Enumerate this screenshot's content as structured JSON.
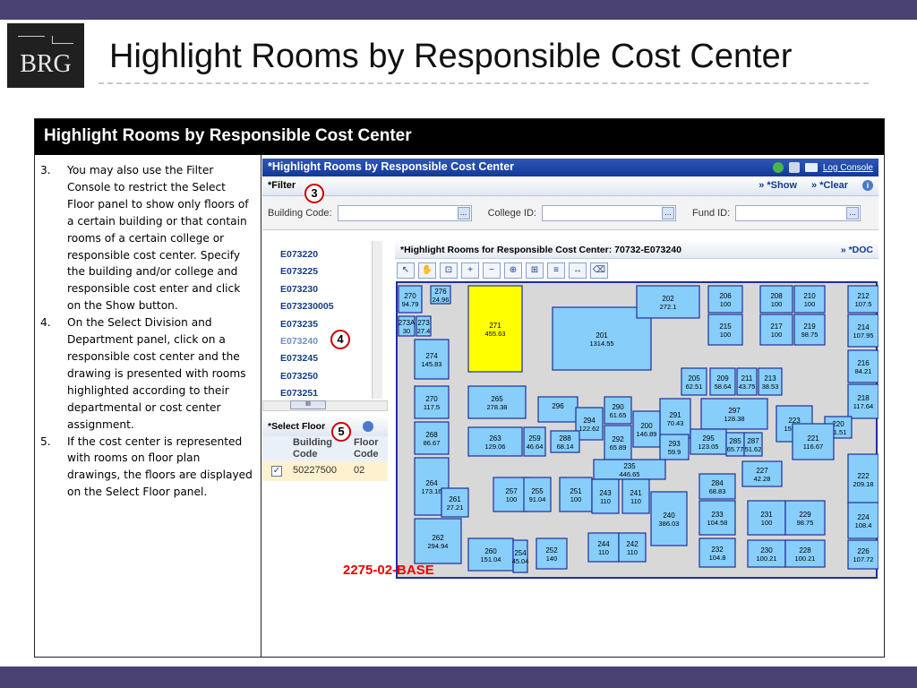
{
  "slide": {
    "logo_text": "BRG",
    "title": "Highlight Rooms by Responsible Cost Center",
    "section_header": "Highlight Rooms by Responsible Cost Center"
  },
  "steps": [
    {
      "num": "3.",
      "text": "You may also use the Filter Console to restrict the Select Floor panel to show only floors of a certain building or that contain rooms of a certain college or responsible cost center.  Specify the building and/or college and responsible cost enter and click on the Show button."
    },
    {
      "num": "4.",
      "text": "On the Select Division and Department panel, click on a responsible cost center and the drawing is presented with rooms highlighted according to their departmental or cost center assignment."
    },
    {
      "num": "5.",
      "text": "If the cost center is represented with rooms on floor plan drawings, the floors are displayed on the Select Floor panel."
    }
  ],
  "app": {
    "title": "*Highlight Rooms by Responsible Cost Center",
    "log_console": "Log Console",
    "filter_label": "*Filter",
    "show_label": "» *Show",
    "clear_label": "» *Clear",
    "building_code_label": "Building Code:",
    "college_id_label": "College ID:",
    "fund_id_label": "Fund ID:",
    "dept_list": [
      "E073220",
      "E073225",
      "E073230",
      "E073230005",
      "E073235",
      "E073240",
      "E073245",
      "E073250",
      "E073251"
    ],
    "scroll_handle": "III",
    "select_floor_label": "*Select Floor",
    "floor_table": {
      "headers": [
        "Building Code",
        "Floor Code"
      ],
      "rows": [
        {
          "building": "50227500",
          "floor": "02"
        }
      ]
    },
    "drawing_title": "*Highlight Rooms for Responsible Cost Center: 70732-E073240",
    "doc_label": "» *DOC",
    "drawing_name": "2275-02-BASE"
  },
  "callouts": [
    "3",
    "4",
    "5"
  ],
  "colors": {
    "bar": "#4a4270",
    "header": "#000000",
    "room_blue": "#87cefa",
    "highlight": "#ffff00",
    "badge": "#cc0000"
  },
  "rooms": [
    {
      "label": "270",
      "area": "94.79"
    },
    {
      "label": "276",
      "area": "24.96"
    },
    {
      "label": "271",
      "area": "455.63",
      "highlight": true
    },
    {
      "label": "201",
      "area": "1314.55"
    },
    {
      "label": "202",
      "area": "272.1"
    },
    {
      "label": "206",
      "area": "100"
    },
    {
      "label": "208",
      "area": "100"
    },
    {
      "label": "210",
      "area": "100"
    },
    {
      "label": "212",
      "area": "107.5"
    },
    {
      "label": "273A",
      "area": "30"
    },
    {
      "label": "273",
      "area": "27.4"
    },
    {
      "label": "215",
      "area": "100"
    },
    {
      "label": "217",
      "area": "100"
    },
    {
      "label": "219",
      "area": "98.75"
    },
    {
      "label": "214",
      "area": "107.95"
    },
    {
      "label": "274",
      "area": "145.83"
    },
    {
      "label": "205",
      "area": "62.51"
    },
    {
      "label": "209",
      "area": "58.64"
    },
    {
      "label": "211",
      "area": "43.75"
    },
    {
      "label": "213",
      "area": "38.53"
    },
    {
      "label": "216",
      "area": "84.21"
    },
    {
      "label": "270",
      "area": "117.5"
    },
    {
      "label": "265",
      "area": "278.38"
    },
    {
      "label": "296",
      "area": ""
    },
    {
      "label": "290",
      "area": "61.65"
    },
    {
      "label": "291",
      "area": "70.43"
    },
    {
      "label": "297",
      "area": "128.38"
    },
    {
      "label": "218",
      "area": "117.64"
    },
    {
      "label": "268",
      "area": "86.67"
    },
    {
      "label": "294",
      "area": "122.62"
    },
    {
      "label": "200",
      "area": "146.89"
    },
    {
      "label": "223",
      "area": "159.33"
    },
    {
      "label": "220",
      "area": "31.51"
    },
    {
      "label": "263",
      "area": "129.06"
    },
    {
      "label": "259",
      "area": "46.64"
    },
    {
      "label": "288",
      "area": "68.14"
    },
    {
      "label": "292",
      "area": "65.89"
    },
    {
      "label": "293",
      "area": "59.9"
    },
    {
      "label": "295",
      "area": "123.05"
    },
    {
      "label": "285",
      "area": "65.77"
    },
    {
      "label": "287",
      "area": "51.62"
    },
    {
      "label": "221",
      "area": "116.67"
    },
    {
      "label": "264",
      "area": "173.16"
    },
    {
      "label": "235",
      "area": "446.65"
    },
    {
      "label": "227",
      "area": "42.28"
    },
    {
      "label": "222",
      "area": "209.18"
    },
    {
      "label": "261",
      "area": "27.21"
    },
    {
      "label": "257",
      "area": "100"
    },
    {
      "label": "255",
      "area": "91.04"
    },
    {
      "label": "251",
      "area": "100"
    },
    {
      "label": "243",
      "area": "110"
    },
    {
      "label": "241",
      "area": "110"
    },
    {
      "label": "284",
      "area": "68.83"
    },
    {
      "label": "240",
      "area": "386.03"
    },
    {
      "label": "233",
      "area": "104.58"
    },
    {
      "label": "231",
      "area": "100"
    },
    {
      "label": "229",
      "area": "98.75"
    },
    {
      "label": "224",
      "area": "108.4"
    },
    {
      "label": "262",
      "area": "294.94"
    },
    {
      "label": "260",
      "area": "151.04"
    },
    {
      "label": "254",
      "area": "45.04"
    },
    {
      "label": "252",
      "area": "140"
    },
    {
      "label": "244",
      "area": "110"
    },
    {
      "label": "242",
      "area": "110"
    },
    {
      "label": "232",
      "area": "104.8"
    },
    {
      "label": "230",
      "area": "100.21"
    },
    {
      "label": "228",
      "area": "100.21"
    },
    {
      "label": "226",
      "area": "107.72"
    }
  ]
}
